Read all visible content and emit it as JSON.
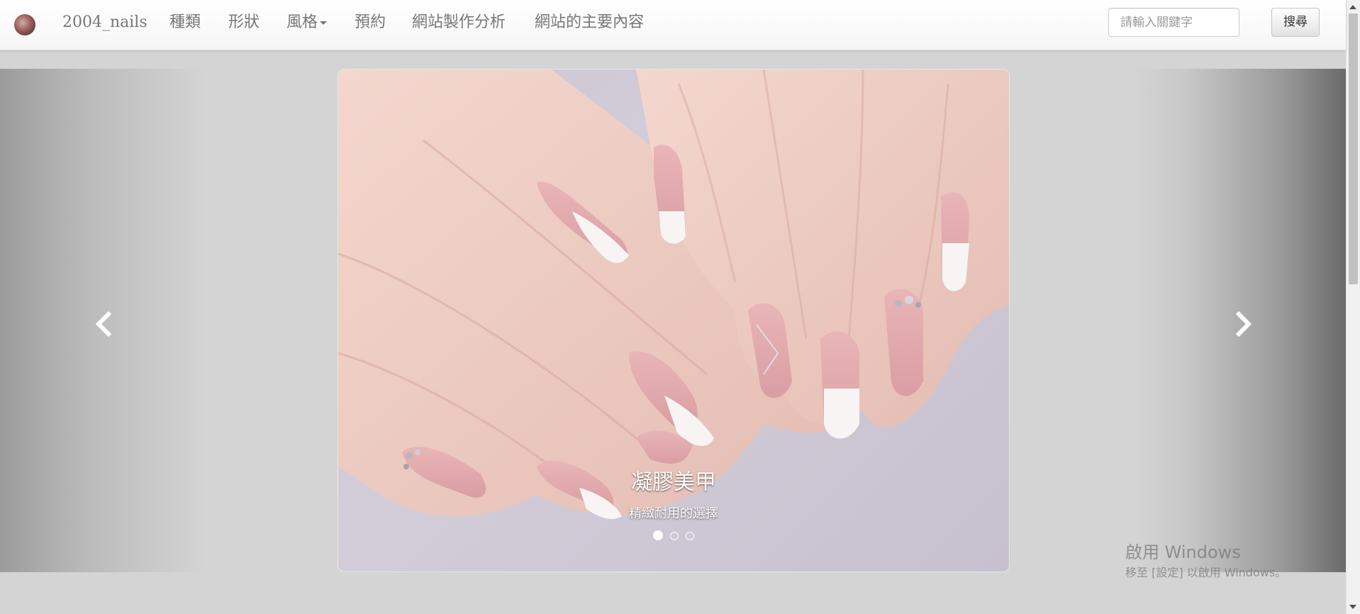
{
  "navbar": {
    "brand": "2004_nails",
    "items": [
      {
        "label": "種類"
      },
      {
        "label": "形狀"
      },
      {
        "label": "風格"
      },
      {
        "label": "預約"
      },
      {
        "label": "網站製作分析"
      },
      {
        "label": "網站的主要內容"
      }
    ],
    "search": {
      "placeholder": "請輸入關鍵字",
      "value": "",
      "button_label": "搜尋"
    }
  },
  "carousel": {
    "caption_title": "凝膠美甲",
    "caption_subtitle": "精緻耐用的選擇",
    "slide_count": 3,
    "active_index": 0,
    "prev_icon": "chevron-left-icon",
    "next_icon": "chevron-right-icon"
  },
  "watermark": {
    "title": "啟用 Windows",
    "subtitle": "移至 [設定] 以啟用 Windows。"
  },
  "colors": {
    "nav_text": "#777777",
    "page_background": "#d4d4d4",
    "caption_text": "#ffffff"
  }
}
